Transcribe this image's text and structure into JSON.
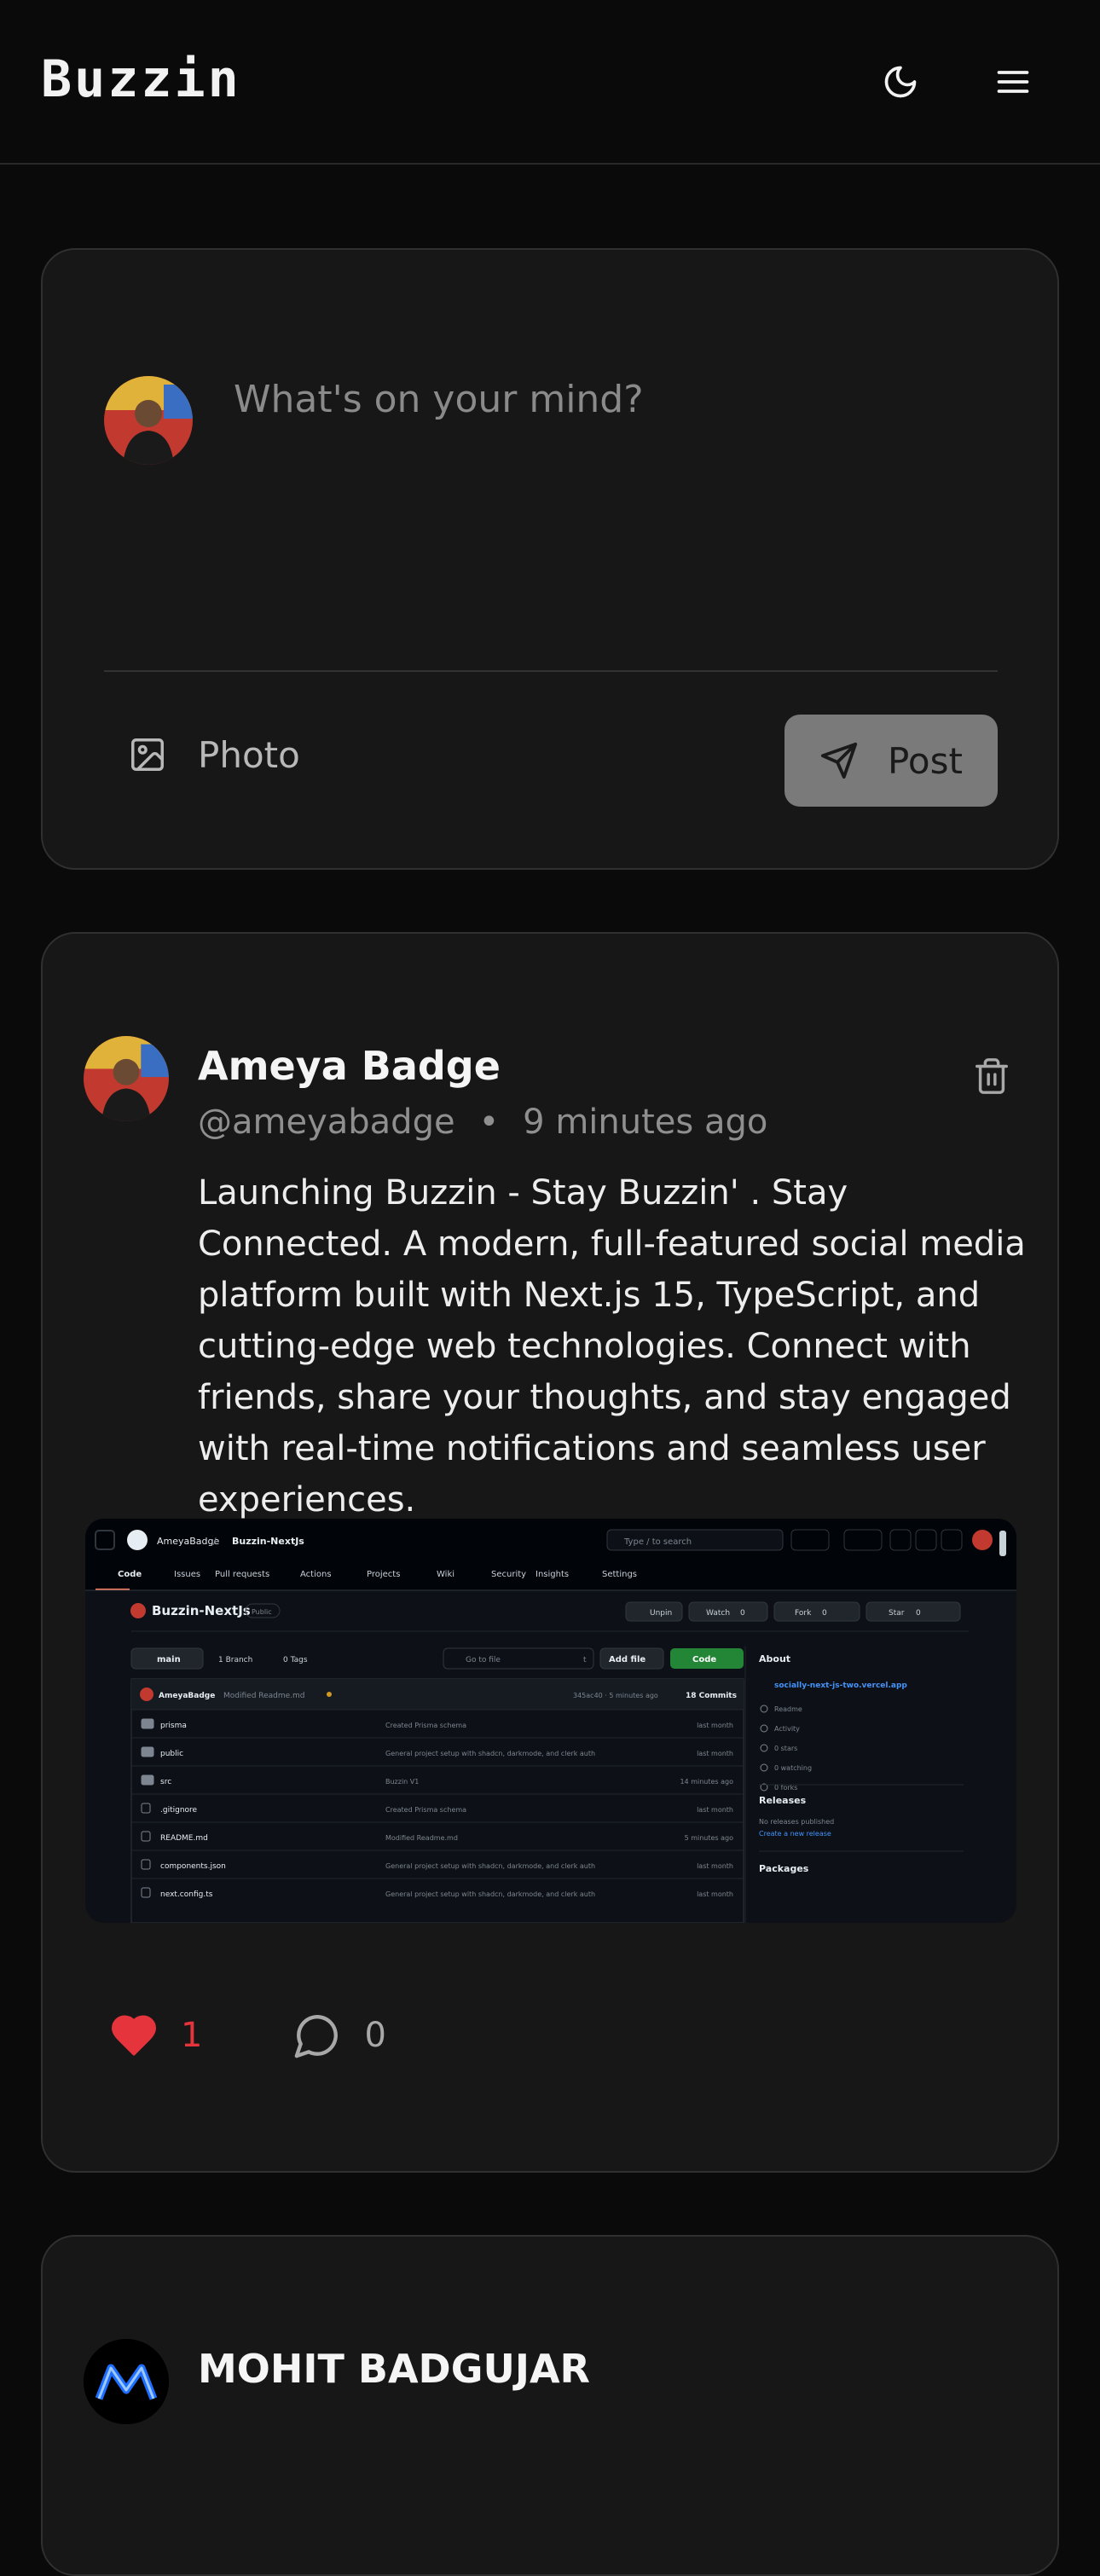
{
  "header": {
    "brand": "Buzzin"
  },
  "composer": {
    "placeholder": "What's on your mind?",
    "photo_label": "Photo",
    "post_label": "Post"
  },
  "post1": {
    "author_name": "Ameya Badge",
    "handle": "@ameyabadge",
    "separator": "•",
    "time": "9 minutes ago",
    "content": "Launching Buzzin - Stay Buzzin' . Stay Connected. A modern, full-featured social media platform built with Next.js 15, TypeScript, and cutting-edge web technologies. Connect with friends, share your thoughts, and stay engaged with real-time notifications and seamless user experiences.",
    "likes": "1",
    "comments": "0",
    "image": {
      "owner": "AmeyaBadge",
      "slash": "/",
      "repo": "Buzzin-NextJs",
      "search": "Type / to search",
      "tabs": [
        "Code",
        "Issues",
        "Pull requests",
        "Actions",
        "Projects",
        "Wiki",
        "Security",
        "Insights",
        "Settings"
      ],
      "repo_title": "Buzzin-NextJs",
      "visibility": "Public",
      "unpin": "Unpin",
      "watch": "Watch",
      "watch_count": "0",
      "fork": "Fork",
      "fork_count": "0",
      "star": "Star",
      "star_count": "0",
      "branch": "main",
      "branches": "1 Branch",
      "tags": "0 Tags",
      "go_to_file": "Go to file",
      "go_to_file_key": "t",
      "add_file": "Add file",
      "code_btn": "Code",
      "commit_author": "AmeyaBadge",
      "commit_msg": "Modified Readme.md",
      "commit_hash": "345ac40 · 5 minutes ago",
      "commits": "18 Commits",
      "files": [
        {
          "name": "prisma",
          "msg": "Created Prisma schema",
          "time": "last month",
          "dir": true
        },
        {
          "name": "public",
          "msg": "General project setup with shadcn, darkmode, and clerk auth",
          "time": "last month",
          "dir": true
        },
        {
          "name": "src",
          "msg": "Buzzin V1",
          "time": "14 minutes ago",
          "dir": true
        },
        {
          "name": ".gitignore",
          "msg": "Created Prisma schema",
          "time": "last month",
          "dir": false
        },
        {
          "name": "README.md",
          "msg": "Modified Readme.md",
          "time": "5 minutes ago",
          "dir": false
        },
        {
          "name": "components.json",
          "msg": "General project setup with shadcn, darkmode, and clerk auth",
          "time": "last month",
          "dir": false
        },
        {
          "name": "next.config.ts",
          "msg": "General project setup with shadcn, darkmode, and clerk auth",
          "time": "last month",
          "dir": false
        }
      ],
      "about": "About",
      "link": "socially-next-js-two.vercel.app",
      "about_items": [
        "Readme",
        "Activity",
        "0 stars",
        "0 watching",
        "0 forks"
      ],
      "releases": "Releases",
      "no_releases": "No releases published",
      "create_release": "Create a new release",
      "packages": "Packages"
    }
  },
  "post2": {
    "author_name": "MOHIT BADGUJAR"
  },
  "colors": {
    "like": "#e5343c",
    "background": "#0a0a0a",
    "card": "#171717"
  }
}
